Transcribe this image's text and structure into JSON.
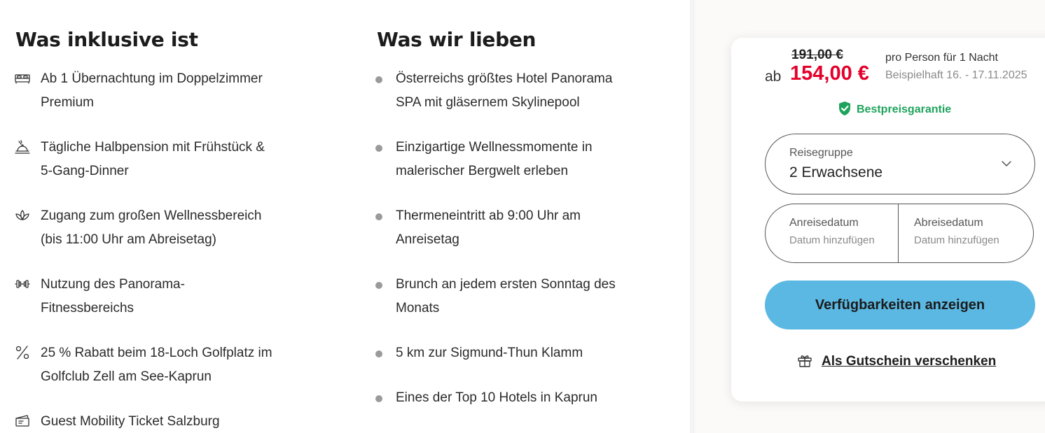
{
  "inclusive": {
    "title": "Was inklusive ist",
    "items": [
      {
        "icon": "bed-icon",
        "text_line1": "Ab 1 Übernachtung im Doppelzimmer",
        "text_line2": "Premium"
      },
      {
        "icon": "dining-cloche-icon",
        "text_line1": "Tägliche Halbpension mit Frühstück &",
        "text_line2": "5-Gang-Dinner"
      },
      {
        "icon": "lotus-icon",
        "text_line1": "Zugang zum großen Wellnessbereich",
        "text_line2": "(bis 11:00 Uhr am Abreisetag)"
      },
      {
        "icon": "dumbbell-icon",
        "text_line1": "Nutzung des Panorama-",
        "text_line2": "Fitnessbereichs"
      },
      {
        "icon": "percent-icon",
        "text_line1": "25 % Rabatt beim 18-Loch Golfplatz im",
        "text_line2": "Golfclub Zell am See-Kaprun"
      },
      {
        "icon": "ticket-icon",
        "text_line1": "Guest Mobility Ticket Salzburg",
        "text_line2": ""
      }
    ]
  },
  "love": {
    "title": "Was wir lieben",
    "items": [
      {
        "text_line1": "Österreichs größtes Hotel Panorama",
        "text_line2": "SPA mit gläsernem Skylinepool"
      },
      {
        "text_line1": "Einzigartige Wellnessmomente in",
        "text_line2": "malerischer Bergwelt erleben"
      },
      {
        "text_line1": "Thermeneintritt ab 9:00 Uhr am",
        "text_line2": "Anreisetag"
      },
      {
        "text_line1": "Brunch an jedem ersten Sonntag des",
        "text_line2": "Monats"
      },
      {
        "text_line1": "5 km zur Sigmund-Thun Klamm",
        "text_line2": ""
      },
      {
        "text_line1": "Eines der Top 10 Hotels in Kaprun",
        "text_line2": ""
      }
    ]
  },
  "booking": {
    "price_old": "191,00 €",
    "price_prefix": "ab",
    "price_new": "154,00 €",
    "price_per": "pro Person für 1 Nacht",
    "price_example": "Beispielhaft 16. - 17.11.2025",
    "bestprice_label": "Bestpreisgarantie",
    "travel_group_label": "Reisegruppe",
    "travel_group_value": "2 Erwachsene",
    "arrival_label": "Anreisedatum",
    "arrival_placeholder": "Datum hinzufügen",
    "departure_label": "Abreisedatum",
    "departure_placeholder": "Datum hinzufügen",
    "cta_label": "Verfügbarkeiten anzeigen",
    "voucher_label": "Als Gutschein verschenken"
  },
  "colors": {
    "price_red": "#e4002b",
    "bestprice_green": "#1ea35c",
    "cta_blue": "#5bb8e2",
    "bullet_gray": "#9a9a9a"
  }
}
